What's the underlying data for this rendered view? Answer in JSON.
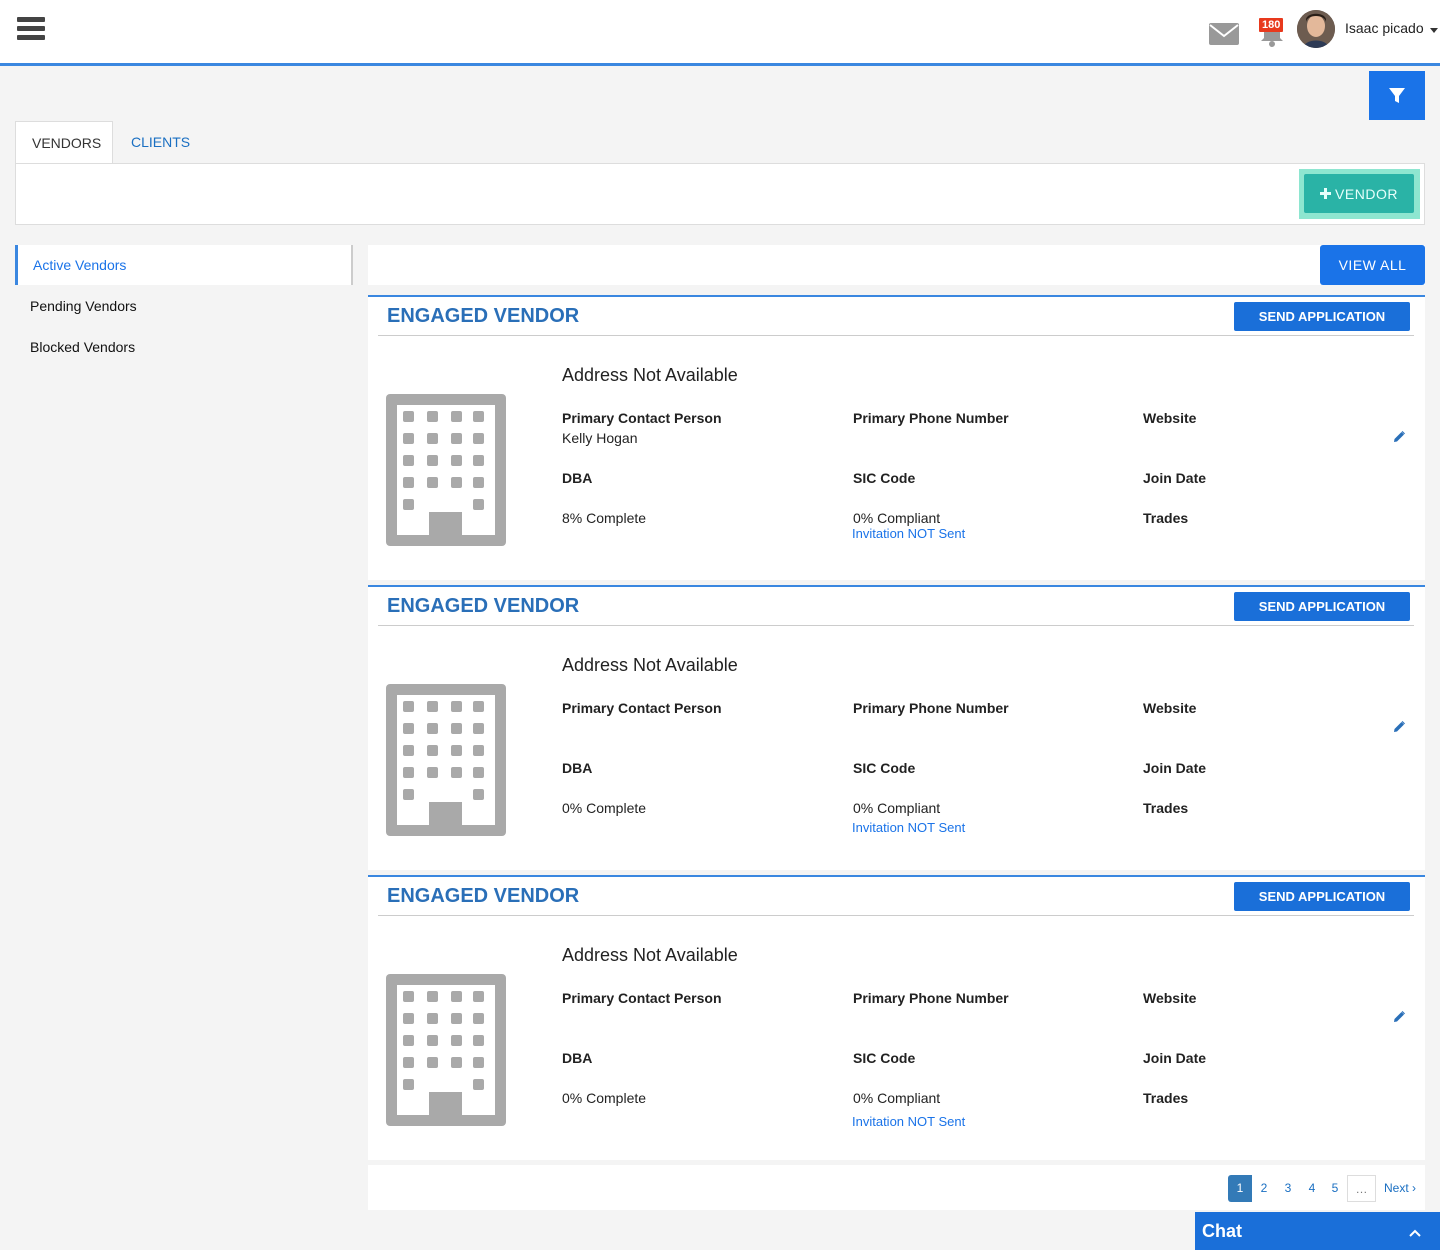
{
  "header": {
    "notification_count": "180",
    "user_name": "Isaac picado"
  },
  "tabs": [
    {
      "label": "VENDORS"
    },
    {
      "label": "CLIENTS"
    }
  ],
  "actions": {
    "add_vendor_label": "VENDOR",
    "view_all_label": "VIEW ALL"
  },
  "sidebar": {
    "items": [
      {
        "label": "Active Vendors"
      },
      {
        "label": "Pending Vendors"
      },
      {
        "label": "Blocked Vendors"
      }
    ]
  },
  "labels": {
    "primary_contact": "Primary Contact Person",
    "primary_phone": "Primary Phone Number",
    "website": "Website",
    "dba": "DBA",
    "sic_code": "SIC Code",
    "join_date": "Join Date",
    "trades": "Trades"
  },
  "vendors": [
    {
      "title": "ENGAGED VENDOR",
      "send_label": "SEND APPLICATION",
      "address": "Address Not Available",
      "contact_person": "Kelly Hogan",
      "complete": "8% Complete",
      "compliant": "0% Compliant",
      "invitation": "Invitation NOT Sent"
    },
    {
      "title": "ENGAGED VENDOR",
      "send_label": "SEND APPLICATION",
      "address": "Address Not Available",
      "contact_person": "",
      "complete": "0% Complete",
      "compliant": "0% Compliant",
      "invitation": "Invitation NOT Sent"
    },
    {
      "title": "ENGAGED VENDOR",
      "send_label": "SEND APPLICATION",
      "address": "Address Not Available",
      "contact_person": "",
      "complete": "0% Complete",
      "compliant": "0% Compliant",
      "invitation": "Invitation NOT Sent"
    }
  ],
  "pagination": {
    "pages": [
      "1",
      "2",
      "3",
      "4",
      "5"
    ],
    "ellipsis": "…",
    "next": "Next ›",
    "current": "1"
  },
  "chat": {
    "label": "Chat"
  }
}
